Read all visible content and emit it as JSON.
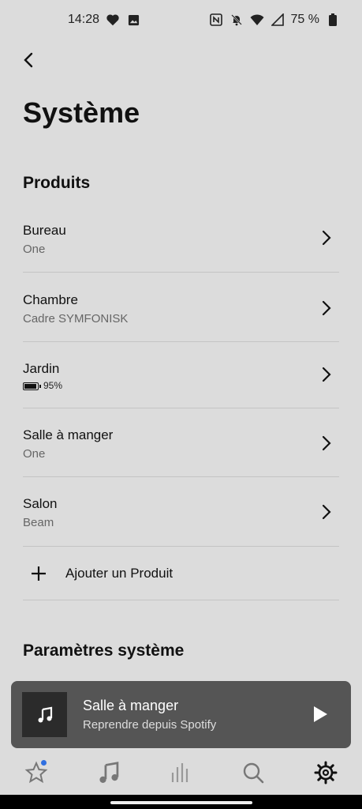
{
  "status_bar": {
    "time": "14:28",
    "battery_text": "75 %"
  },
  "header": {
    "title": "Système"
  },
  "products_section": {
    "title": "Produits",
    "items": [
      {
        "name": "Bureau",
        "subtitle": "One"
      },
      {
        "name": "Chambre",
        "subtitle": "Cadre SYMFONISK"
      },
      {
        "name": "Jardin",
        "subtitle": "95%",
        "battery_level": 0.95
      },
      {
        "name": "Salle à manger",
        "subtitle": "One"
      },
      {
        "name": "Salon",
        "subtitle": "Beam"
      }
    ],
    "add_label": "Ajouter un Produit"
  },
  "system_section": {
    "title": "Paramètres système"
  },
  "mini_player": {
    "title": "Salle à manger",
    "subtitle": "Reprendre depuis Spotify"
  },
  "bottom_nav": {
    "items": [
      "favorites",
      "music",
      "rooms",
      "search",
      "settings"
    ],
    "active": "settings"
  },
  "colors": {
    "background": "#dcdcdc",
    "player_bg": "#555555",
    "notification_dot": "#2f6fe0"
  }
}
